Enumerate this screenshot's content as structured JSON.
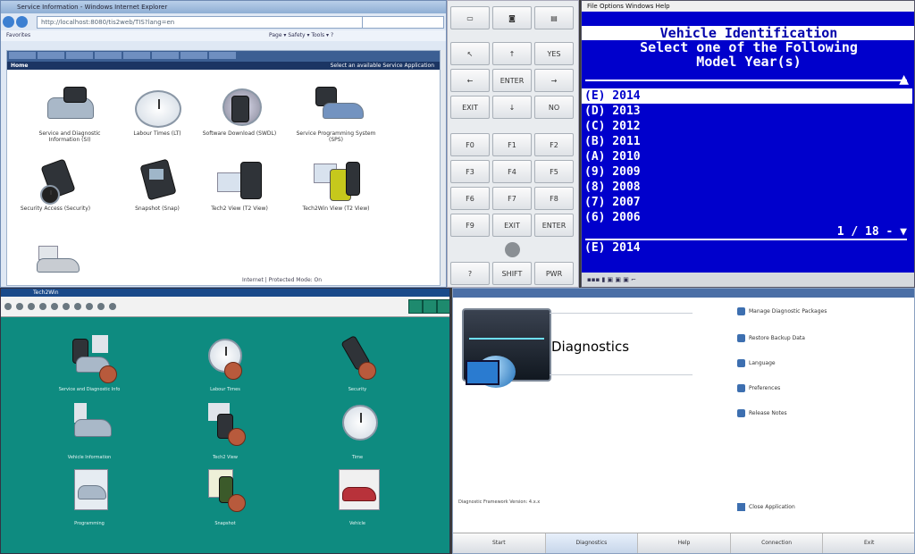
{
  "top_left": {
    "window_title": "Service Information - Windows Internet Explorer",
    "address": "http://localhost:8080/tis2web/TIS?lang=en",
    "favorites": "Favorites",
    "commands": "Page  ▾  Safety ▾  Tools ▾  ?",
    "subbar_left": "Home",
    "subbar_right": "Select an available Service Application",
    "tiles": [
      {
        "label": "Service and Diagnostic Information (SI)"
      },
      {
        "label": "Labour Times (LT)"
      },
      {
        "label": "Software Download (SWDL)"
      },
      {
        "label": "Service Programming System (SPS)"
      },
      {
        "label": "Security Access (Security)"
      },
      {
        "label": "Snapshot (Snap)"
      },
      {
        "label": "Tech2 View (T2 View)"
      },
      {
        "label": "Tech2Win View (T2 View)"
      },
      {
        "label": ""
      }
    ],
    "status": "Internet | Protected Mode: On"
  },
  "keypad": {
    "keys": [
      "",
      "",
      "",
      "",
      "↑",
      "YES",
      "←",
      "ENTER",
      "→",
      "EXIT",
      "↓",
      "NO",
      "F0",
      "F1",
      "F2",
      "F3",
      "F4",
      "F5",
      "F6",
      "F7",
      "F8",
      "F9",
      "EXIT",
      "ENTER",
      "?",
      "SHIFT",
      "PWR"
    ]
  },
  "tech2": {
    "menu": "File  Options  Windows  Help",
    "heading": "Vehicle Identification",
    "prompt_line1": "Select one of the Following",
    "prompt_line2": "Model Year(s)",
    "years": [
      "(E) 2014",
      "(D) 2013",
      "(C) 2012",
      "(B) 2011",
      "(A) 2010",
      "(9) 2009",
      "(8) 2008",
      "(7) 2007",
      "(6) 2006"
    ],
    "pager": "1 / 18 -",
    "selected_summary": "(E) 2014"
  },
  "teal": {
    "window_title": "Tech2Win",
    "tiles": [
      {
        "label": "Service and Diagnostic Info"
      },
      {
        "label": "Labour Times"
      },
      {
        "label": "Security"
      },
      {
        "label": "Vehicle Information"
      },
      {
        "label": "Tech2 View"
      },
      {
        "label": "Time"
      },
      {
        "label": "Programming"
      },
      {
        "label": "Snapshot"
      },
      {
        "label": "Vehicle"
      }
    ]
  },
  "diagnostics": {
    "title": "Diagnostics",
    "menu": [
      {
        "label": "Manage Diagnostic Packages"
      },
      {
        "label": "Restore Backup Data"
      },
      {
        "label": "Language"
      },
      {
        "label": "Preferences"
      },
      {
        "label": "Release Notes"
      }
    ],
    "footer_line1": "Diagnostic Framework Version: 4.x.x",
    "footer_line2": "",
    "exit_label": "Close Application",
    "taskbar": [
      "Start",
      "Diagnostics",
      "Help",
      "Connection",
      "Exit"
    ]
  }
}
